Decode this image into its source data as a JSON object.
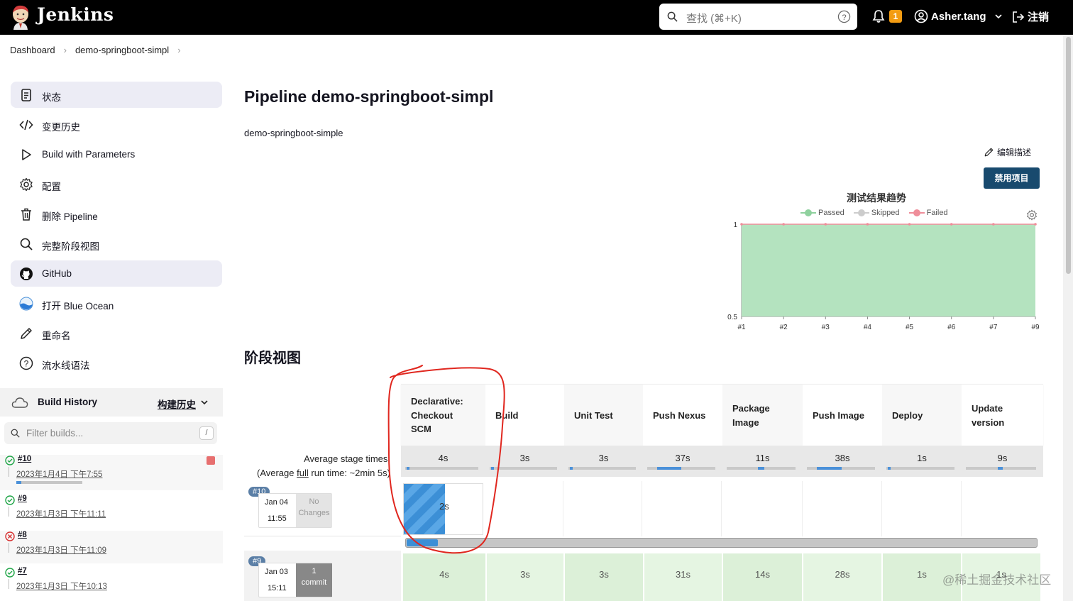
{
  "header": {
    "brand": "Jenkins",
    "search_placeholder": "查找 (⌘+K)",
    "notification_count": "1",
    "username": "Asher.tang",
    "logout": "注销"
  },
  "breadcrumb": [
    "Dashboard",
    "demo-springboot-simpl"
  ],
  "sidebar": {
    "items": [
      {
        "label": "状态",
        "icon": "status-icon",
        "active": true
      },
      {
        "label": "变更历史",
        "icon": "code-icon"
      },
      {
        "label": "Build with Parameters",
        "icon": "play-icon"
      },
      {
        "label": "配置",
        "icon": "gear-icon"
      },
      {
        "label": "删除 Pipeline",
        "icon": "trash-icon"
      },
      {
        "label": "完整阶段视图",
        "icon": "search-icon"
      },
      {
        "label": "GitHub",
        "icon": "github-icon",
        "active": true
      },
      {
        "label": "打开 Blue Ocean",
        "icon": "blue-ocean-icon"
      },
      {
        "label": "重命名",
        "icon": "pencil-icon"
      },
      {
        "label": "流水线语法",
        "icon": "help-icon"
      }
    ],
    "build_history": {
      "title": "Build History",
      "title_cn": "构建历史",
      "filter_placeholder": "Filter builds...",
      "filter_shortcut": "/",
      "builds": [
        {
          "num": "#10",
          "date": "2023年1月4日 下午7:55",
          "status": "running",
          "progress": 0.08
        },
        {
          "num": "#9",
          "date": "2023年1月3日 下午11:11",
          "status": "success"
        },
        {
          "num": "#8",
          "date": "2023年1月3日 下午11:09",
          "status": "failed"
        },
        {
          "num": "#7",
          "date": "2023年1月3日 下午10:13",
          "status": "success"
        }
      ]
    }
  },
  "main": {
    "title": "Pipeline demo-springboot-simpl",
    "description": "demo-springboot-simple",
    "edit_description": "编辑描述",
    "disable_button": "禁用项目",
    "stage_view_title": "阶段视图"
  },
  "chart_data": {
    "type": "area",
    "title": "测试结果趋势",
    "legend": [
      "Passed",
      "Skipped",
      "Failed"
    ],
    "legend_position": "top",
    "categories": [
      "#1",
      "#2",
      "#3",
      "#4",
      "#5",
      "#6",
      "#7",
      "#9"
    ],
    "series": [
      {
        "name": "Passed",
        "values": [
          1,
          1,
          1,
          1,
          1,
          1,
          1,
          1
        ],
        "color": "#b4e3bf"
      },
      {
        "name": "Skipped",
        "values": [
          0,
          0,
          0,
          0,
          0,
          0,
          0,
          0
        ],
        "color": "#cccccc"
      },
      {
        "name": "Failed",
        "values": [
          0,
          0,
          0,
          0,
          0,
          0,
          0,
          0
        ],
        "color": "#ef8e9a"
      }
    ],
    "yticks": [
      "1",
      "0.5"
    ],
    "ylim": [
      0.5,
      1
    ]
  },
  "stage_view": {
    "avg_label_1": "Average stage times:",
    "avg_label_2a": "(Average ",
    "avg_label_2b": "full",
    "avg_label_2c": " run time: ~2min 5s)",
    "stages": [
      {
        "name": "Declarative: Checkout SCM",
        "avg": "4s",
        "avg_frac": 0.03
      },
      {
        "name": "Build",
        "avg": "3s",
        "avg_frac": 0.03
      },
      {
        "name": "Unit Test",
        "avg": "3s",
        "avg_frac": 0.02
      },
      {
        "name": "Push Nexus",
        "avg": "37s",
        "avg_frac": 0.35
      },
      {
        "name": "Package Image",
        "avg": "11s",
        "avg_frac": 0.1
      },
      {
        "name": "Push Image",
        "avg": "38s",
        "avg_frac": 0.36
      },
      {
        "name": "Deploy",
        "avg": "1s",
        "avg_frac": 0.01
      },
      {
        "name": "Update version",
        "avg": "9s",
        "avg_frac": 0.08
      }
    ],
    "runs": [
      {
        "tag": "#10",
        "date": "Jan 04",
        "time": "11:55",
        "changes": "No Changes",
        "current_stage": "2s",
        "progress": 0.05,
        "stage_times": []
      },
      {
        "tag": "#9",
        "date": "Jan 03",
        "time": "15:11",
        "changes_count": "1",
        "changes_label": "commit",
        "stage_times": [
          "4s",
          "3s",
          "3s",
          "31s",
          "14s",
          "28s",
          "1s",
          "1s"
        ]
      }
    ]
  },
  "watermark": "@稀土掘金技术社区"
}
